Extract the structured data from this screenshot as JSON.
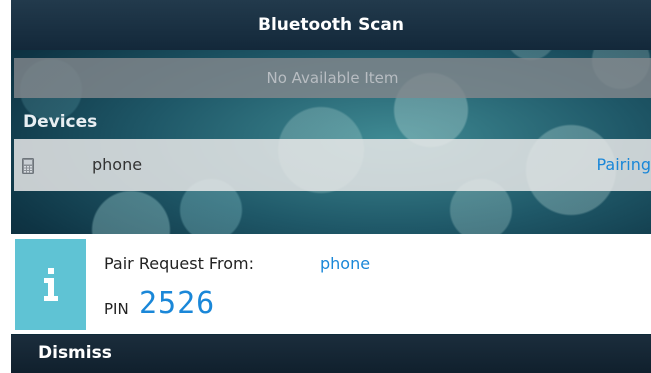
{
  "header": {
    "title": "Bluetooth Scan"
  },
  "scan_list": {
    "empty_text": "No Available Item"
  },
  "devices": {
    "section_label": "Devices",
    "items": [
      {
        "icon": "mobile-phone-icon",
        "name": "phone",
        "status": "Pairing"
      }
    ]
  },
  "pair_dialog": {
    "icon": "info-icon",
    "request_label": "Pair Request From:",
    "device_name": "phone",
    "pin_label": "PIN",
    "pin_value": "2526"
  },
  "footer": {
    "dismiss_label": "Dismiss"
  },
  "colors": {
    "accent_blue": "#1a87d8",
    "info_cyan": "#5fc3d4",
    "header_bg": "#13283a"
  }
}
